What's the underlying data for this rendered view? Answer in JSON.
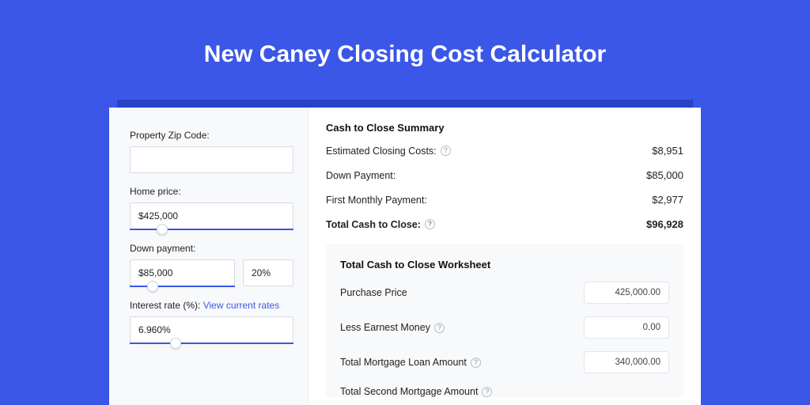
{
  "title": "New Caney Closing Cost Calculator",
  "form": {
    "zip_label": "Property Zip Code:",
    "zip_value": "",
    "price_label": "Home price:",
    "price_value": "$425,000",
    "price_slider_pos": "20%",
    "down_label": "Down payment:",
    "down_value": "$85,000",
    "down_pct_value": "20%",
    "down_slider_pos": "22%",
    "rate_label": "Interest rate (%):",
    "rate_link": "View current rates",
    "rate_value": "6.960%",
    "rate_slider_pos": "28%"
  },
  "summary": {
    "heading": "Cash to Close Summary",
    "est_label": "Estimated Closing Costs:",
    "est_value": "$8,951",
    "down_label": "Down Payment:",
    "down_value": "$85,000",
    "first_label": "First Monthly Payment:",
    "first_value": "$2,977",
    "total_label": "Total Cash to Close:",
    "total_value": "$96,928"
  },
  "worksheet": {
    "heading": "Total Cash to Close Worksheet",
    "rows": {
      "purchase_label": "Purchase Price",
      "purchase_value": "425,000.00",
      "earnest_label": "Less Earnest Money",
      "earnest_value": "0.00",
      "loan_label": "Total Mortgage Loan Amount",
      "loan_value": "340,000.00",
      "second_label": "Total Second Mortgage Amount"
    }
  }
}
